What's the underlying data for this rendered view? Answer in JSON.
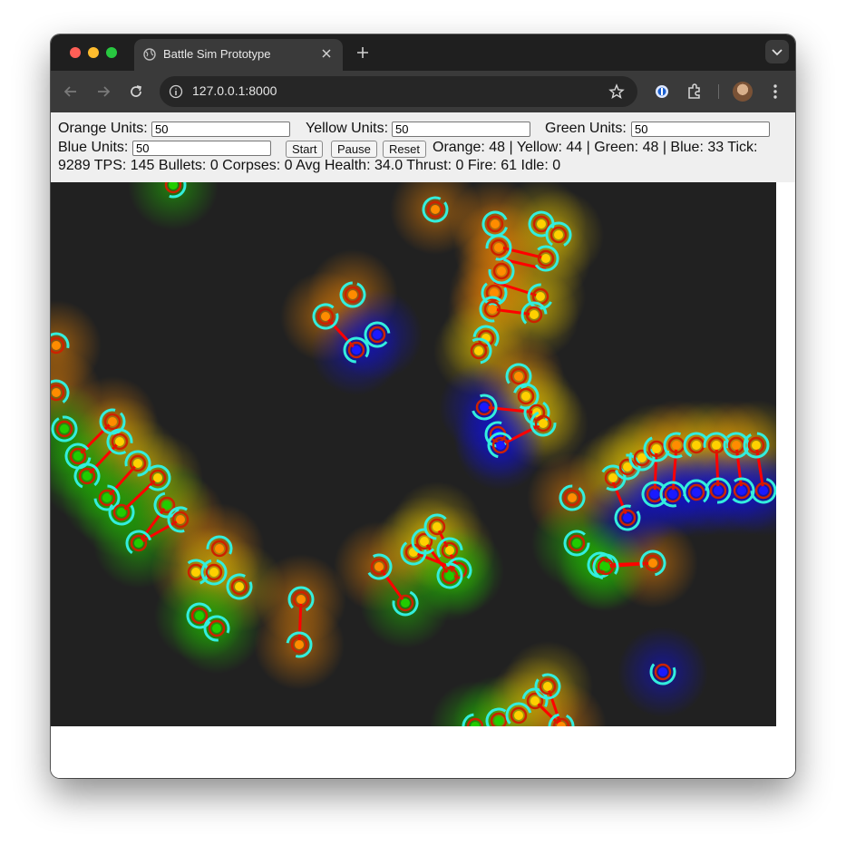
{
  "browser": {
    "tab_title": "Battle Sim Prototype",
    "url": "127.0.0.1:8000",
    "icons": [
      "globe-icon",
      "close-icon",
      "plus-icon",
      "chevron-down-icon",
      "back-arrow-icon",
      "forward-arrow-icon",
      "reload-icon",
      "site-info-icon",
      "bookmark-star-icon",
      "password-extension-icon",
      "extensions-puzzle-icon",
      "profile-avatar",
      "kebab-menu-icon"
    ]
  },
  "controls": {
    "orange_label": "Orange Units:",
    "orange_value": "50",
    "yellow_label": "Yellow Units:",
    "yellow_value": "50",
    "green_label": "Green Units:",
    "green_value": "50",
    "blue_label": "Blue Units:",
    "blue_value": "50",
    "start_label": "Start",
    "pause_label": "Pause",
    "reset_label": "Reset",
    "status_line1": "Orange: 48 | Yellow: 44 | Green: 48 | Blue: 33 Tick:",
    "status_line2": "9289 TPS: 145 Bullets: 0 Corpses: 0 Avg Health: 34.0 Thrust: 0 Fire: 61 Idle: 0"
  },
  "colors": {
    "orange": "#ff8c00",
    "yellow": "#ffd000",
    "green": "#22cc00",
    "blue": "#1a1aff",
    "health_ring": "#33eedd",
    "laser": "#ff0000",
    "canvas_bg": "#212121"
  }
}
